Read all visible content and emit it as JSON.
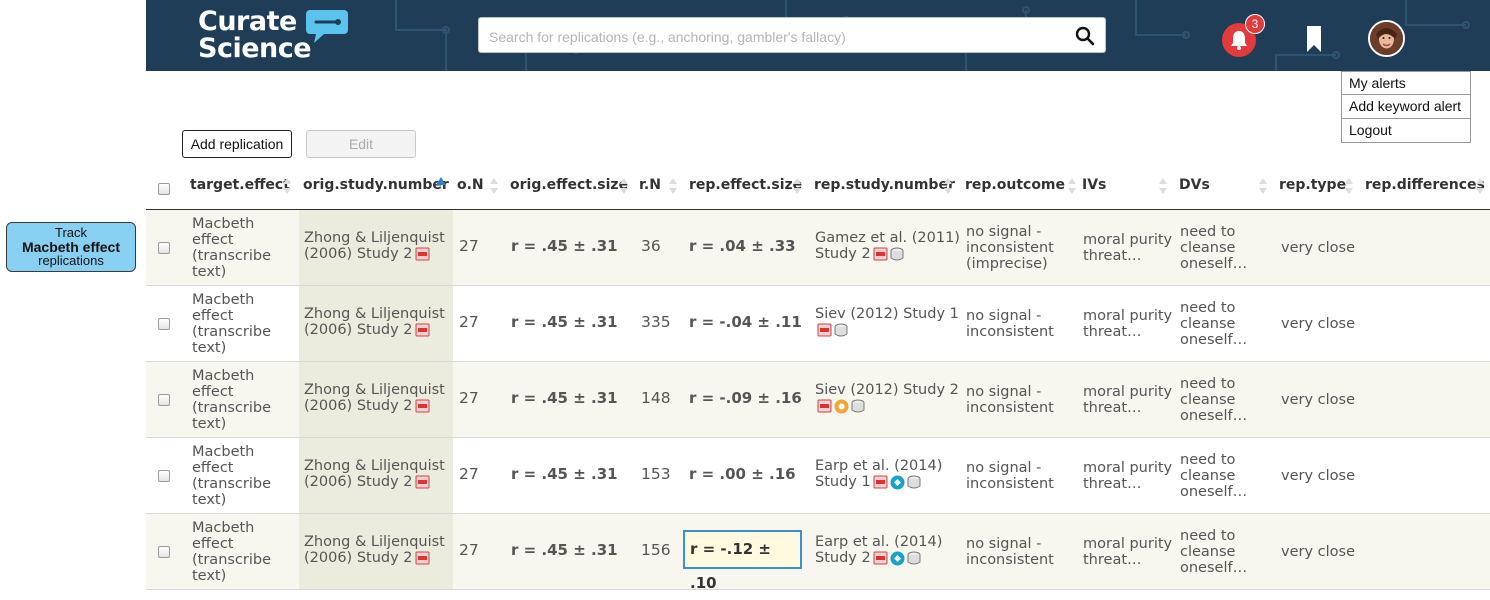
{
  "header": {
    "logo_line1": "Curate",
    "logo_line2": "Science",
    "search_placeholder": "Search for replications (e.g., anchoring, gambler's fallacy)",
    "notification_count": "3"
  },
  "user_menu": {
    "items": [
      "My alerts",
      "Add keyword alert",
      "Logout"
    ]
  },
  "track_button": {
    "line1": "Track",
    "line2": "Macbeth effect",
    "line3": "replications"
  },
  "actions": {
    "add_label": "Add replication",
    "edit_label": "Edit"
  },
  "table": {
    "columns": [
      "target.effect",
      "orig.study.number",
      "o.N",
      "orig.effect.size",
      "r.N",
      "rep.effect.size",
      "rep.study.number",
      "rep.outcome",
      "IVs",
      "DVs",
      "rep.type",
      "rep.differences"
    ],
    "rows": [
      {
        "target_effect": [
          "Macbeth",
          "effect",
          "(transcribe",
          "text)"
        ],
        "orig_study": [
          "Zhong & Liljenquist",
          "(2006) Study 2"
        ],
        "o_n": "27",
        "orig_effect": "r = .45 ± .31",
        "r_n": "36",
        "rep_effect": "r = .04 ± .33",
        "rep_study": [
          "Gamez et al. (2011)",
          "Study 2"
        ],
        "rep_outcome": [
          "no signal -",
          "inconsistent",
          "(imprecise)"
        ],
        "ivs": [
          "moral purity",
          "threat…"
        ],
        "dvs": [
          "need to",
          "cleanse",
          "oneself…"
        ],
        "rep_type": "very close"
      },
      {
        "target_effect": [
          "Macbeth",
          "effect",
          "(transcribe",
          "text)"
        ],
        "orig_study": [
          "Zhong & Liljenquist",
          "(2006) Study 2"
        ],
        "o_n": "27",
        "orig_effect": "r = .45 ± .31",
        "r_n": "335",
        "rep_effect": "r = -.04 ± .11",
        "rep_study": [
          "Siev (2012) Study 1",
          ""
        ],
        "rep_outcome": [
          "no signal -",
          "inconsistent"
        ],
        "ivs": [
          "moral purity",
          "threat…"
        ],
        "dvs": [
          "need to",
          "cleanse",
          "oneself…"
        ],
        "rep_type": "very close"
      },
      {
        "target_effect": [
          "Macbeth",
          "effect",
          "(transcribe",
          "text)"
        ],
        "orig_study": [
          "Zhong & Liljenquist",
          "(2006) Study 2"
        ],
        "o_n": "27",
        "orig_effect": "r = .45 ± .31",
        "r_n": "148",
        "rep_effect": "r = -.09 ± .16",
        "rep_study": [
          "Siev (2012) Study 2",
          ""
        ],
        "rep_outcome": [
          "no signal -",
          "inconsistent"
        ],
        "ivs": [
          "moral purity",
          "threat…"
        ],
        "dvs": [
          "need to",
          "cleanse",
          "oneself…"
        ],
        "rep_type": "very close"
      },
      {
        "target_effect": [
          "Macbeth",
          "effect",
          "(transcribe",
          "text)"
        ],
        "orig_study": [
          "Zhong & Liljenquist",
          "(2006) Study 2"
        ],
        "o_n": "27",
        "orig_effect": "r = .45 ± .31",
        "r_n": "153",
        "rep_effect": "r = .00 ± .16",
        "rep_study": [
          "Earp et al. (2014)",
          "Study 1"
        ],
        "rep_outcome": [
          "no signal -",
          "inconsistent"
        ],
        "ivs": [
          "moral purity",
          "threat…"
        ],
        "dvs": [
          "need to",
          "cleanse",
          "oneself…"
        ],
        "rep_type": "very close"
      },
      {
        "target_effect": [
          "Macbeth",
          "effect",
          "(transcribe",
          "text)"
        ],
        "orig_study": [
          "Zhong & Liljenquist",
          "(2006) Study 2"
        ],
        "o_n": "27",
        "orig_effect": "r = .45 ± .31",
        "r_n": "156",
        "rep_effect": "r = -.12 ± .10",
        "rep_study": [
          "Earp et al. (2014)",
          "Study 2"
        ],
        "rep_outcome": [
          "no signal -",
          "inconsistent"
        ],
        "ivs": [
          "moral purity",
          "threat…"
        ],
        "dvs": [
          "need to",
          "cleanse",
          "oneself…"
        ],
        "rep_type": "very close"
      }
    ]
  },
  "colors": {
    "header_bg": "#1f3d56",
    "track_button_bg": "#87d0f2",
    "notification_red": "#e33b3b",
    "edit_focus_border": "#3b8fd4"
  }
}
